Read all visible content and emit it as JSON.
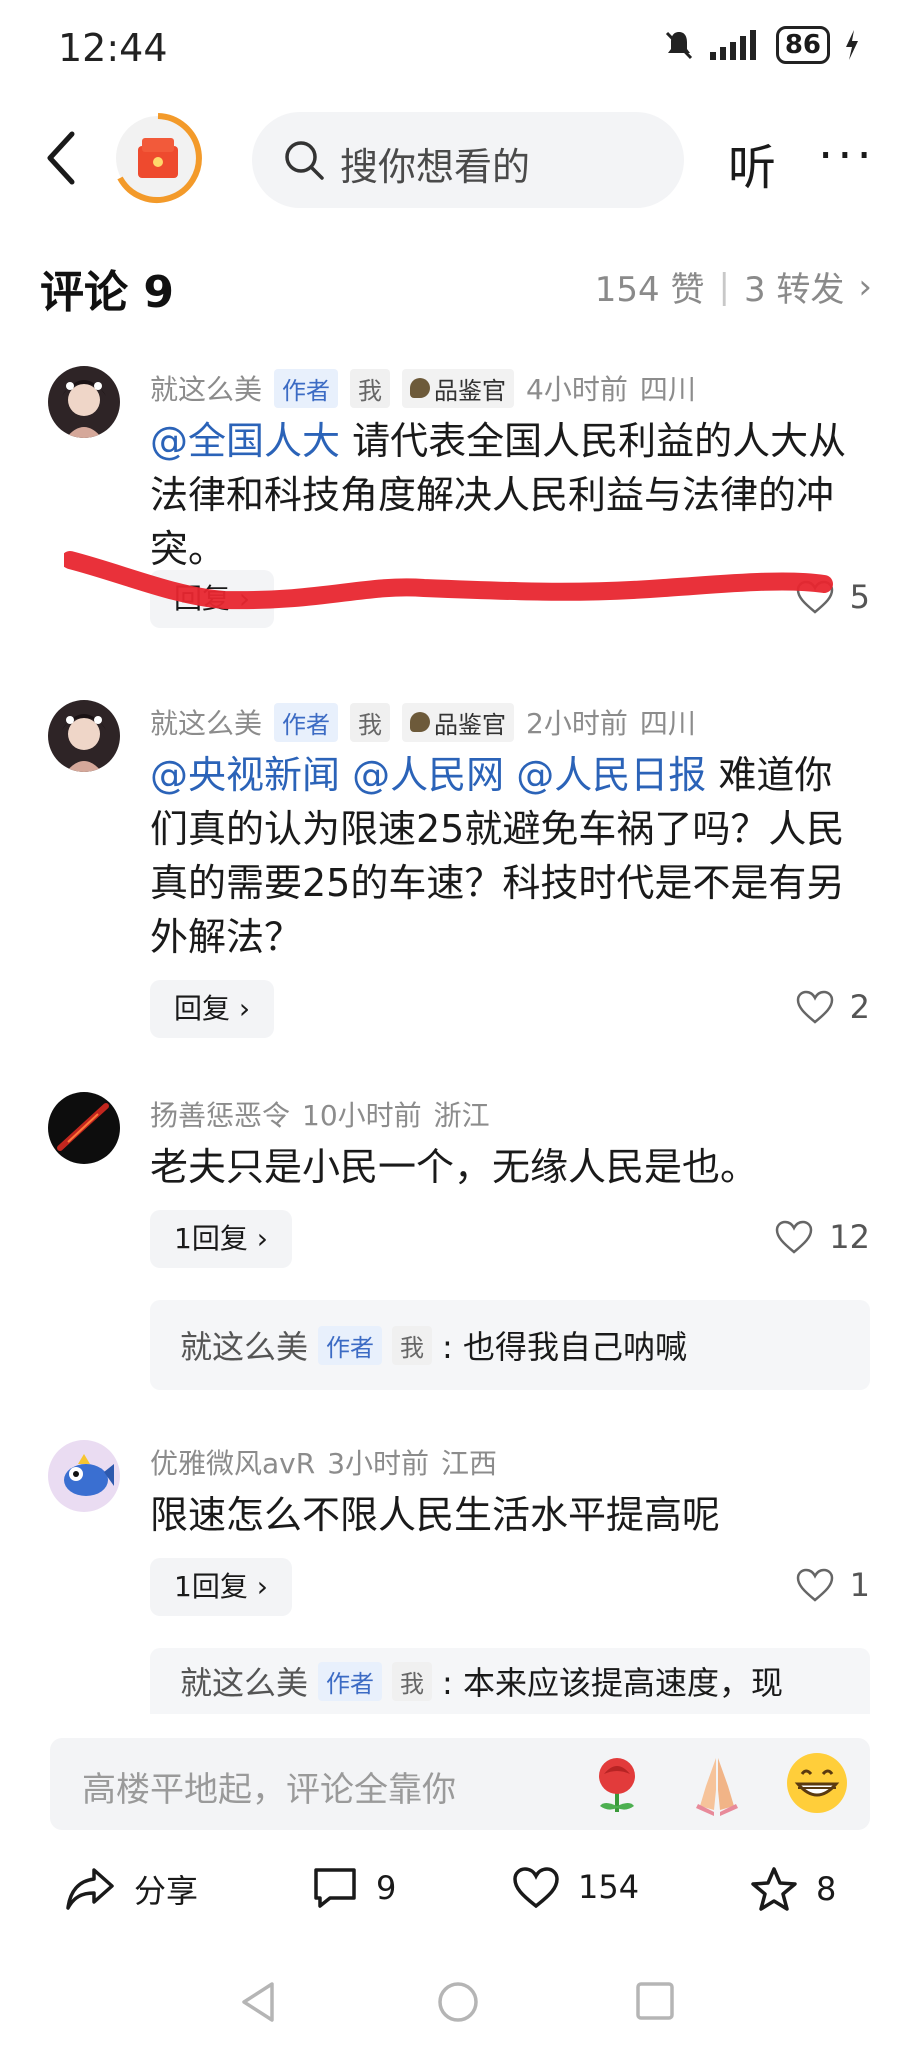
{
  "status_bar": {
    "time": "12:44",
    "battery": "86"
  },
  "nav": {
    "search_placeholder": "搜你想看的",
    "listen_label": "听",
    "more_label": "···"
  },
  "comments_header": {
    "title": "评论 9",
    "likes": "154 赞",
    "reposts": "3 转发"
  },
  "comments": [
    {
      "user": "就这么美",
      "author_tag": "作者",
      "me_tag": "我",
      "badge": "品鉴官",
      "time": "4小时前",
      "location": "四川",
      "mentions": [
        "@全国人大"
      ],
      "text": "请代表全国人民利益的人大从法律和科技角度解决人民利益与法律的冲突。",
      "reply_label": "回复 ›",
      "likes": "5"
    },
    {
      "user": "就这么美",
      "author_tag": "作者",
      "me_tag": "我",
      "badge": "品鉴官",
      "time": "2小时前",
      "location": "四川",
      "mentions": [
        "@央视新闻",
        "@人民网",
        "@人民日报"
      ],
      "text": "难道你们真的认为限速25就避免车祸了吗？人民真的需要25的车速？科技时代是不是有另外解法？",
      "reply_label": "回复 ›",
      "likes": "2"
    },
    {
      "user": "扬善惩恶令",
      "time": "10小时前",
      "location": "浙江",
      "text": "老夫只是小民一个，无缘人民是也。",
      "reply_label": "1回复 ›",
      "likes": "12",
      "subreply": {
        "user": "就这么美",
        "author_tag": "作者",
        "me_tag": "我",
        "text": ": 也得我自己呐喊"
      }
    },
    {
      "user": "优雅微风avR",
      "time": "3小时前",
      "location": "江西",
      "text": "限速怎么不限人民生活水平提高呢",
      "reply_label": "1回复 ›",
      "likes": "1",
      "subreply": {
        "user": "就这么美",
        "author_tag": "作者",
        "me_tag": "我",
        "text": ": 本来应该提高速度，现"
      }
    }
  ],
  "input_bar": {
    "placeholder": "高楼平地起，评论全靠你"
  },
  "bottom_actions": {
    "share": "分享",
    "comments": "9",
    "likes": "154",
    "favorites": "8"
  },
  "colors": {
    "mention": "#2b63b8",
    "scribble": "#e8262f",
    "accent": "#f0681f"
  }
}
